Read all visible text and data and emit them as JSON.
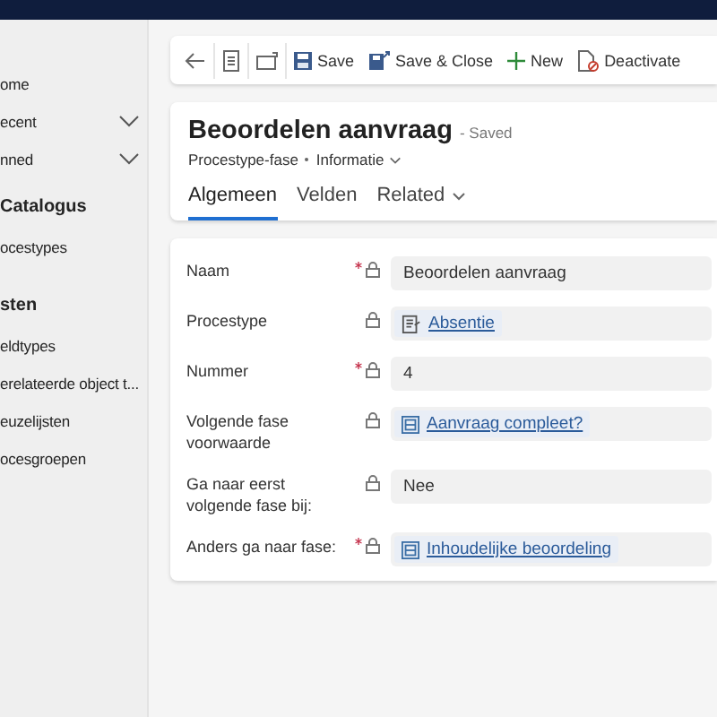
{
  "sidebar": {
    "items": [
      {
        "label": "ome",
        "kind": "link",
        "expandable": false
      },
      {
        "label": "ecent",
        "kind": "link",
        "expandable": true
      },
      {
        "label": "nned",
        "kind": "link",
        "expandable": true
      },
      {
        "label": "Catalogus",
        "kind": "heading",
        "expandable": false
      },
      {
        "label": "ocestypes",
        "kind": "link",
        "expandable": false
      },
      {
        "label": "sten",
        "kind": "heading",
        "expandable": false
      },
      {
        "label": "eldtypes",
        "kind": "link",
        "expandable": false
      },
      {
        "label": "erelateerde object t...",
        "kind": "link",
        "expandable": false
      },
      {
        "label": "euzelijsten",
        "kind": "link",
        "expandable": false
      },
      {
        "label": "ocesgroepen",
        "kind": "link",
        "expandable": false
      }
    ]
  },
  "command_bar": [
    {
      "kind": "back"
    },
    {
      "kind": "record"
    },
    {
      "kind": "popout"
    },
    {
      "kind": "save",
      "label": "Save"
    },
    {
      "kind": "save-close",
      "label": "Save & Close"
    },
    {
      "kind": "new",
      "label": "New"
    },
    {
      "kind": "deactivate",
      "label": "Deactivate"
    }
  ],
  "record": {
    "title": "Beoordelen aanvraag",
    "status": "- Saved",
    "entity": "Procestype-fase",
    "form": "Informatie"
  },
  "tabs": [
    {
      "label": "Algemeen",
      "selected": true,
      "dropdown": false
    },
    {
      "label": "Velden",
      "selected": false,
      "dropdown": false
    },
    {
      "label": "Related",
      "selected": false,
      "dropdown": true
    }
  ],
  "fields": [
    {
      "label": "Naam",
      "required": true,
      "kind": "text",
      "value": "Beoordelen aanvraag"
    },
    {
      "label": "Procestype",
      "required": false,
      "kind": "lookup-entity",
      "value": "Absentie"
    },
    {
      "label": "Nummer",
      "required": true,
      "kind": "text",
      "value": "4"
    },
    {
      "label": "Volgende fase voorwaarde",
      "required": false,
      "kind": "lookup-record",
      "value": "Aanvraag compleet?"
    },
    {
      "label": "Ga naar eerst volgende fase bij:",
      "required": false,
      "kind": "text",
      "value": "Nee"
    },
    {
      "label": "Anders ga naar fase:",
      "required": true,
      "kind": "lookup-record",
      "value": "Inhoudelijke beoordeling"
    }
  ]
}
